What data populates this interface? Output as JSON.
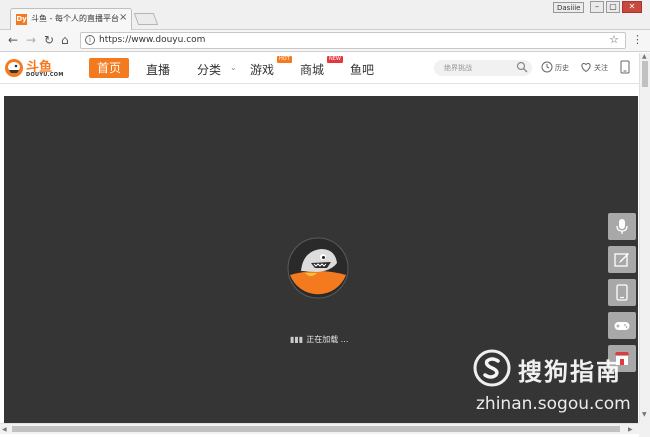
{
  "browser": {
    "tab_title": "斗鱼 - 每个人的直播平台",
    "tab_favicon": "Dy",
    "tab_close": "×",
    "user_badge": "Dasiiie",
    "url": "https://www.douyu.com",
    "icons": [
      "back-arrow-icon",
      "forward-arrow-icon",
      "reload-icon",
      "home-icon",
      "info-icon",
      "star-icon",
      "menu-dots-icon"
    ]
  },
  "site": {
    "logo_cn": "斗鱼",
    "logo_en": "DOUYU.COM",
    "nav": {
      "home": "首页",
      "live": "直播",
      "category": "分类",
      "games": "游戏",
      "games_badge": "HOT",
      "mall": "商城",
      "mall_badge": "NEW",
      "fishbar": "鱼吧"
    },
    "search_placeholder": "绝界挑战",
    "history": "历史",
    "follow": "关注",
    "brand_color": "#f47a1f"
  },
  "content": {
    "loading_text": "正在加载 ...",
    "side_buttons": [
      "microphone-icon",
      "edit-icon",
      "phone-icon",
      "gamepad-icon",
      "shop-icon"
    ]
  },
  "watermark": {
    "cn": "搜狗指南",
    "en": "zhinan.sogou.com"
  }
}
